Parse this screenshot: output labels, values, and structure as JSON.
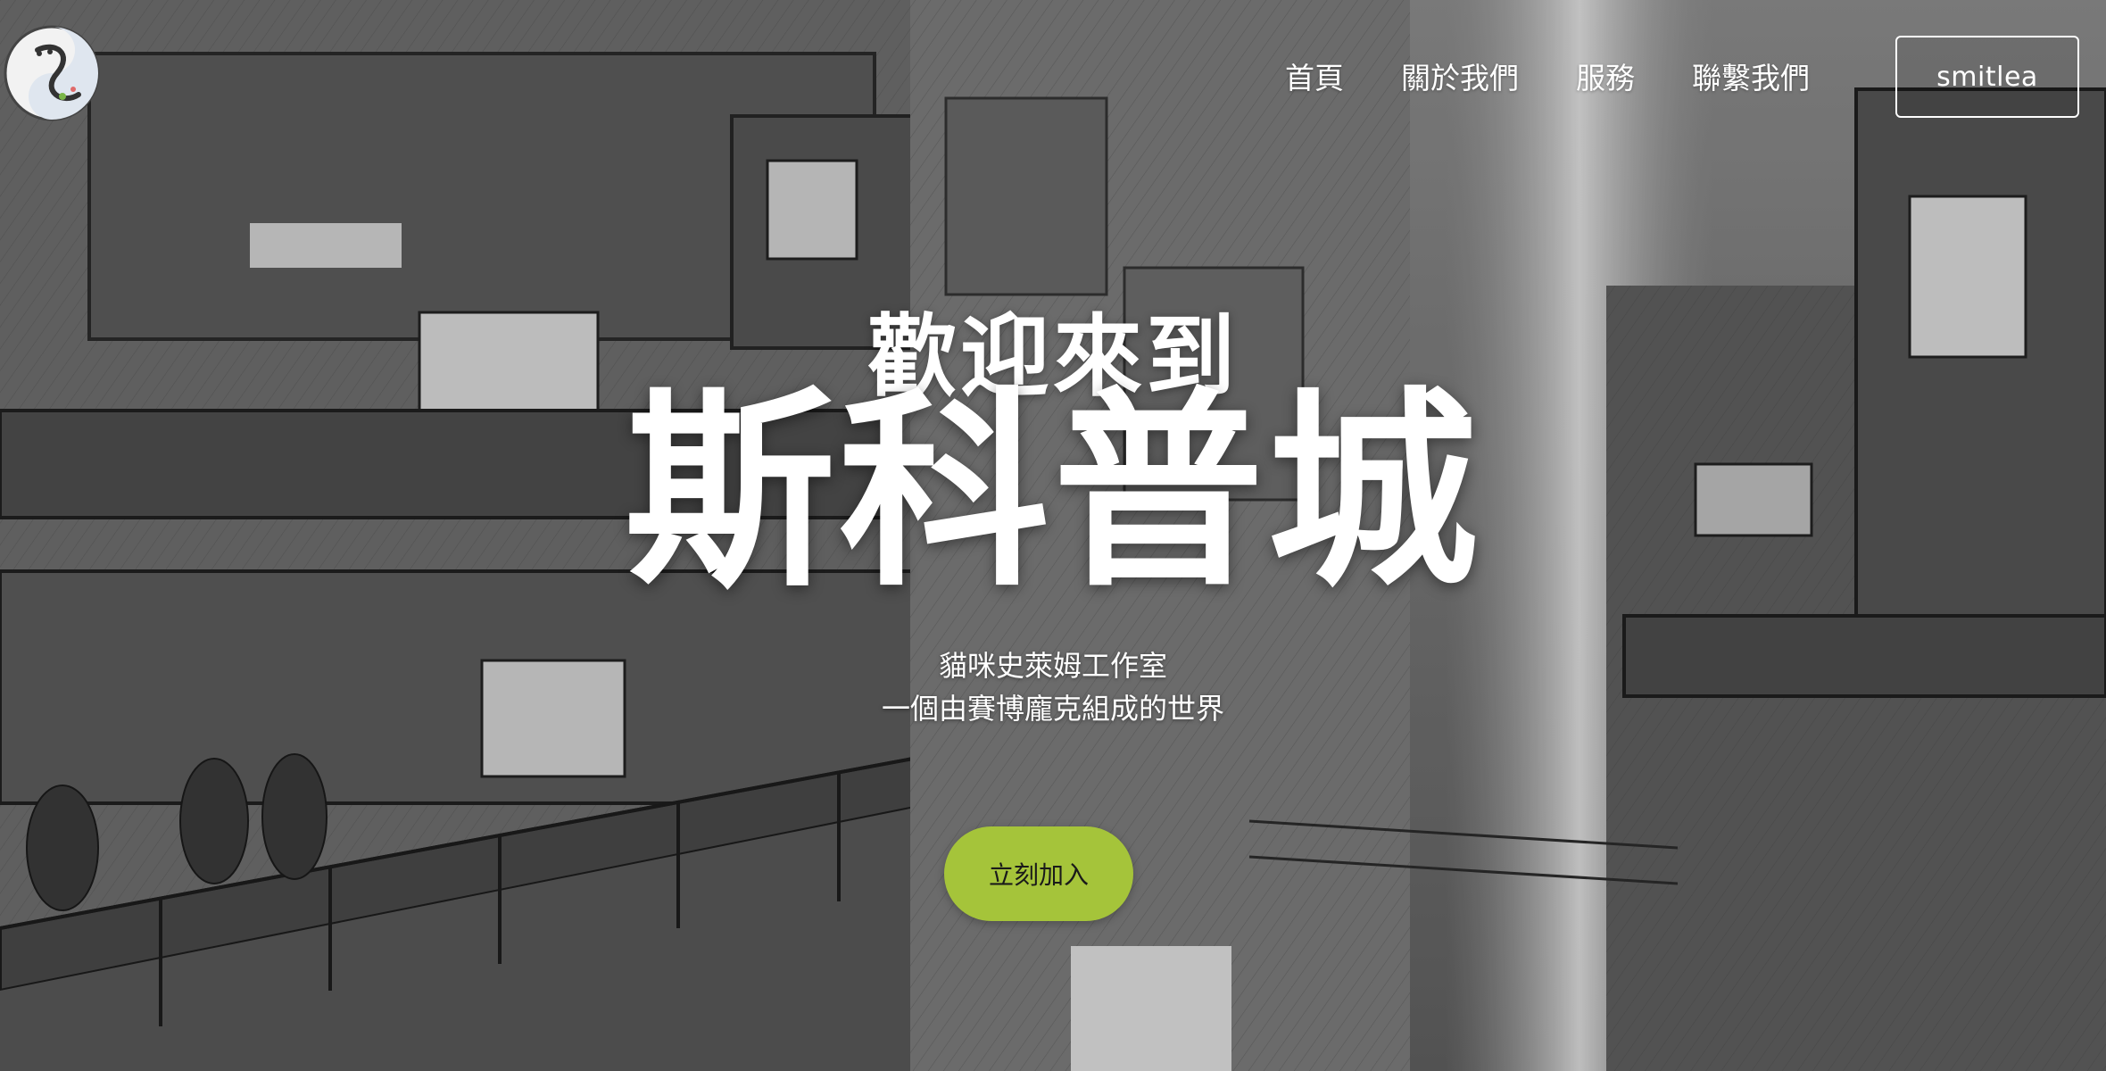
{
  "nav": {
    "items": [
      {
        "label": "首頁"
      },
      {
        "label": "關於我們"
      },
      {
        "label": "服務"
      },
      {
        "label": "聯繫我們"
      }
    ],
    "user_label": "smitlea"
  },
  "hero": {
    "welcome": "歡迎來到",
    "title": "斯科普城",
    "subtitle_line1": "貓咪史萊姆工作室",
    "subtitle_line2": "一個由賽博龐克組成的世界",
    "cta_label": "立刻加入"
  },
  "colors": {
    "cta": "#a5c43a",
    "text": "#ffffff"
  },
  "icons": {
    "logo": "slime-cat-logo"
  }
}
